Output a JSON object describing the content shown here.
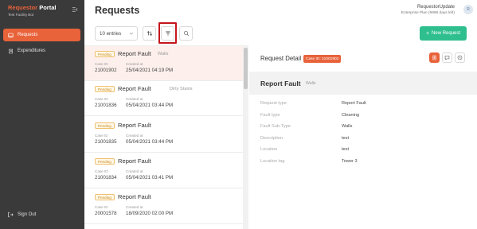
{
  "brand": {
    "name_part1": "Requestor",
    "name_part2": "Portal",
    "subtitle": "Test Facility Bot"
  },
  "sidebar": {
    "items": [
      {
        "label": "Requests",
        "icon": "inbox-icon",
        "active": true
      },
      {
        "label": "Expenditures",
        "icon": "book-icon",
        "active": false
      }
    ],
    "signout": "Sign Out"
  },
  "header": {
    "title": "Requests",
    "user": "RequestorUpdate",
    "plan": "Enterprise Plan (9999 days left)",
    "avatar": "R"
  },
  "toolbar": {
    "entries": "10 entries",
    "new_button": "New Request"
  },
  "requests": [
    {
      "status": "Pending",
      "title": "Report Fault",
      "subtitle": "Walls",
      "case_label": "Case ID",
      "case_id": "21001902",
      "created_label": "Created at",
      "created": "25/04/2021 04:19 PM",
      "selected": true
    },
    {
      "status": "Pending",
      "title": "Report Fault",
      "subtitle": "Dirty Stains",
      "case_label": "Case ID",
      "case_id": "21001836",
      "created_label": "Created at",
      "created": "05/04/2021 03:44 PM",
      "selected": false
    },
    {
      "status": "Pending",
      "title": "Report Fault",
      "subtitle": "",
      "case_label": "Case ID",
      "case_id": "21001835",
      "created_label": "Created at",
      "created": "05/04/2021 03:44 PM",
      "selected": false
    },
    {
      "status": "Pending",
      "title": "Report Fault",
      "subtitle": "",
      "case_label": "Case ID",
      "case_id": "21001834",
      "created_label": "Created at",
      "created": "05/04/2021 03:41 PM",
      "selected": false
    },
    {
      "status": "Pending",
      "title": "Report Fault",
      "subtitle": "",
      "case_label": "Case ID",
      "case_id": "20001578",
      "created_label": "Created at",
      "created": "18/09/2020 02:00 PM",
      "selected": false
    }
  ],
  "detail": {
    "heading": "Request Detail",
    "case_badge": "Case ID: 21001902",
    "title": "Report Fault",
    "subtitle": "Walls",
    "fields": [
      {
        "label": "Request type",
        "value": "Report Fault"
      },
      {
        "label": "Fault type",
        "value": "Cleaning"
      },
      {
        "label": "Fault Sub-Type",
        "value": "Walls"
      },
      {
        "label": "Description",
        "value": "test"
      },
      {
        "label": "Location",
        "value": "test"
      },
      {
        "label": "Location tag",
        "value": "Tower 3"
      }
    ]
  },
  "colors": {
    "accent": "#e8623a",
    "sidebar": "#3a3a3a",
    "success": "#2fbf8f",
    "highlight": "#c4161c"
  }
}
